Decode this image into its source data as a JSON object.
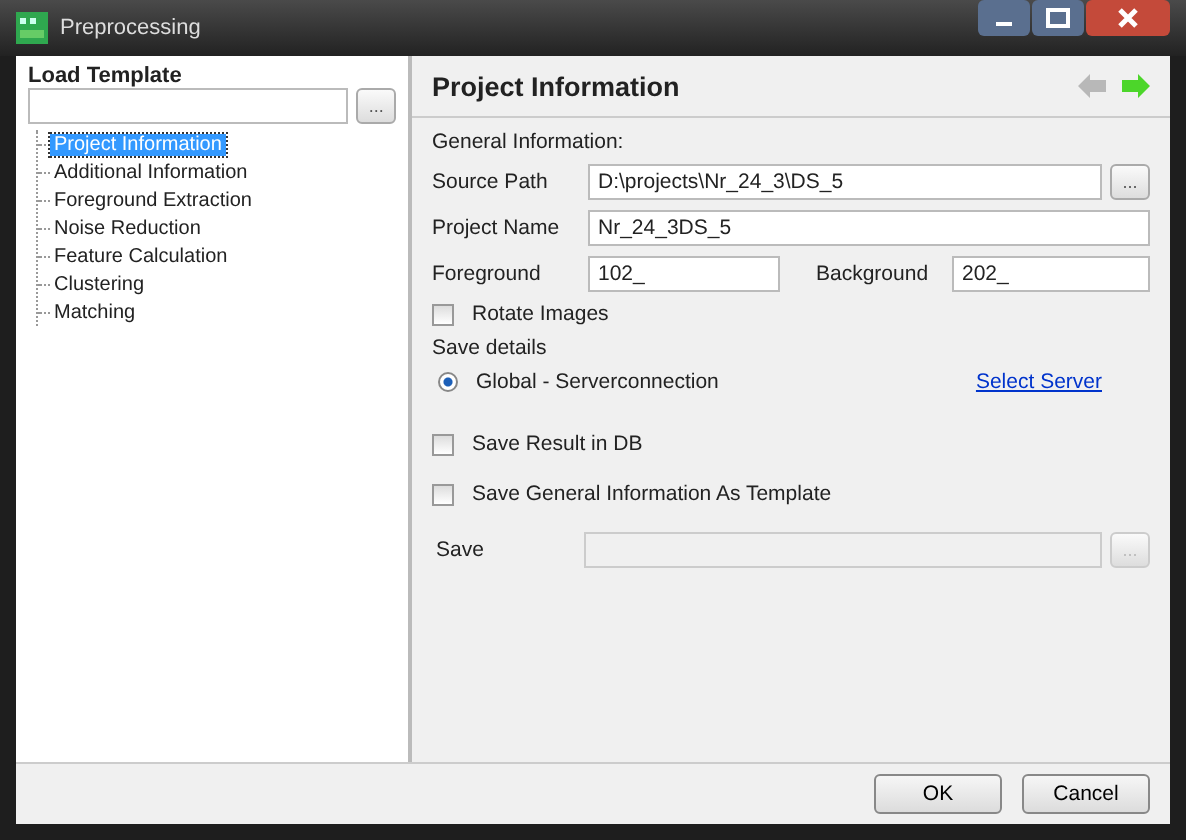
{
  "window": {
    "title": "Preprocessing"
  },
  "load_template": {
    "label": "Load Template",
    "browse": "..."
  },
  "tree": [
    {
      "label": "Project Information",
      "selected": true
    },
    {
      "label": "Additional Information",
      "selected": false
    },
    {
      "label": "Foreground Extraction",
      "selected": false
    },
    {
      "label": "Noise Reduction",
      "selected": false
    },
    {
      "label": "Feature Calculation",
      "selected": false
    },
    {
      "label": "Clustering",
      "selected": false
    },
    {
      "label": "Matching",
      "selected": false
    }
  ],
  "panel": {
    "title": "Project Information",
    "nav": [
      {
        "kind": "back",
        "disabled": true
      },
      {
        "kind": "forward",
        "disabled": false
      }
    ]
  },
  "general_label": "General Information:",
  "source_path": {
    "label": "Source Path",
    "value": "D:\\projects\\Nr_24_3\\DS_5",
    "browse": "..."
  },
  "project_name": {
    "label": "Project Name",
    "value": "Nr_24_3DS_5"
  },
  "foreground": {
    "label": "Foreground",
    "value": "102_"
  },
  "background": {
    "label": "Background",
    "value": "202_"
  },
  "rotate_images": {
    "label": "Rotate Images",
    "checked": false
  },
  "save_details": {
    "label": "Save details",
    "radio": {
      "label": "Global - Serverconnection",
      "selected": true
    },
    "link": "Select Server"
  },
  "save_result": {
    "label": "Save Result in DB",
    "checked": false
  },
  "save_template": {
    "label": "Save General Information As Template",
    "checked": false
  },
  "save_row": {
    "label": "Save",
    "disabled": true,
    "browse": "..."
  },
  "buttons": [
    "OK",
    "Cancel"
  ]
}
